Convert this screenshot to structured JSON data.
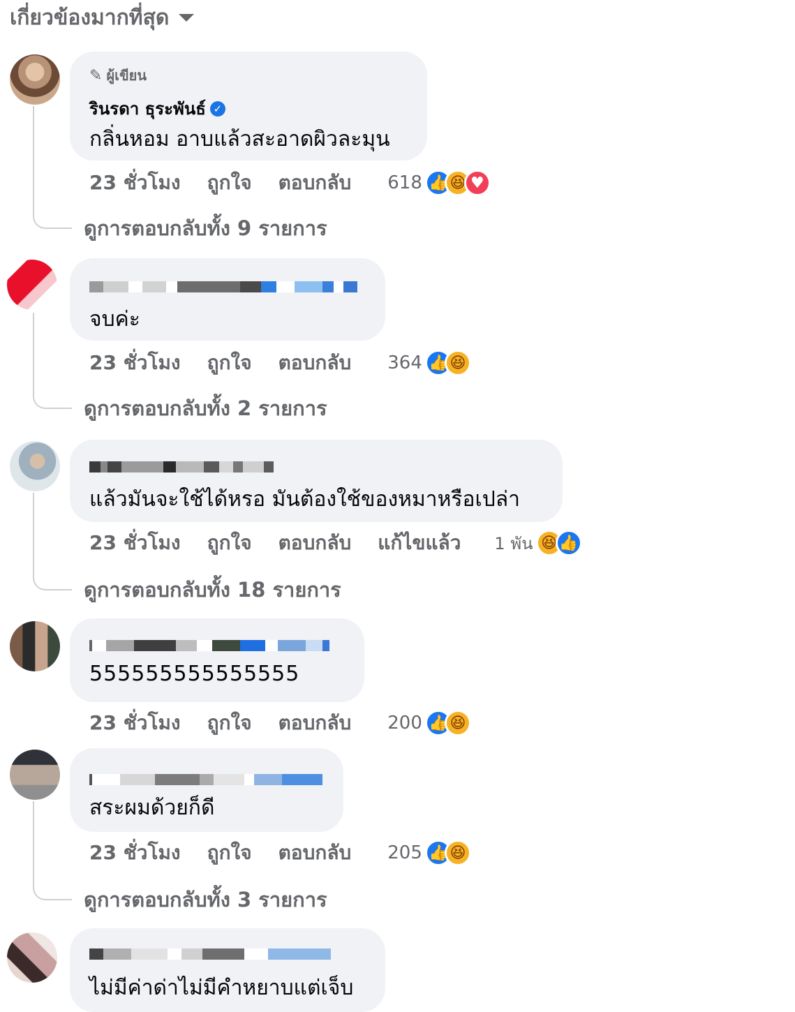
{
  "sort": {
    "label": "เกี่ยวข้องมากที่สุด"
  },
  "comments": [
    {
      "author_badge": "ผู้เขียน",
      "name": "รินรดา ธุระพันธ์",
      "text": "กลิ่นหอม อาบแล้วสะอาดผิวละมุน",
      "time": "23 ชั่วโมง",
      "like": "ถูกใจ",
      "reply": "ตอบกลับ",
      "count": "618",
      "reactions": [
        "like-icon",
        "haha-icon",
        "love-icon"
      ],
      "view_replies": "ดูการตอบกลับทั้ง 9 รายการ"
    },
    {
      "text": "จบค่ะ",
      "time": "23 ชั่วโมง",
      "like": "ถูกใจ",
      "reply": "ตอบกลับ",
      "count": "364",
      "reactions": [
        "like-icon",
        "haha-icon"
      ],
      "view_replies": "ดูการตอบกลับทั้ง 2 รายการ"
    },
    {
      "text": "แล้วมันจะใช้ได้หรอ มันต้องใช้ของหมาหรือเปล่า",
      "time": "23 ชั่วโมง",
      "like": "ถูกใจ",
      "reply": "ตอบกลับ",
      "edited": "แก้ไขแล้ว",
      "count": "1 พัน",
      "reactions": [
        "haha-icon",
        "like-icon"
      ],
      "view_replies": "ดูการตอบกลับทั้ง 18 รายการ"
    },
    {
      "text": "555555555555555",
      "time": "23 ชั่วโมง",
      "like": "ถูกใจ",
      "reply": "ตอบกลับ",
      "count": "200",
      "reactions": [
        "like-icon",
        "haha-icon"
      ]
    },
    {
      "text": "สระผมด้วยก็ดี",
      "time": "23 ชั่วโมง",
      "like": "ถูกใจ",
      "reply": "ตอบกลับ",
      "count": "205",
      "reactions": [
        "like-icon",
        "haha-icon"
      ],
      "view_replies": "ดูการตอบกลับทั้ง 3 รายการ"
    },
    {
      "text": "ไม่มีค่าด่าไม่มีคำหยาบแต่เจ็บ"
    }
  ],
  "colors": {
    "bubble": "#f0f2f5",
    "meta": "#65676b",
    "like": "#1877f2",
    "haha": "#f7b125",
    "love": "#f33e58"
  }
}
